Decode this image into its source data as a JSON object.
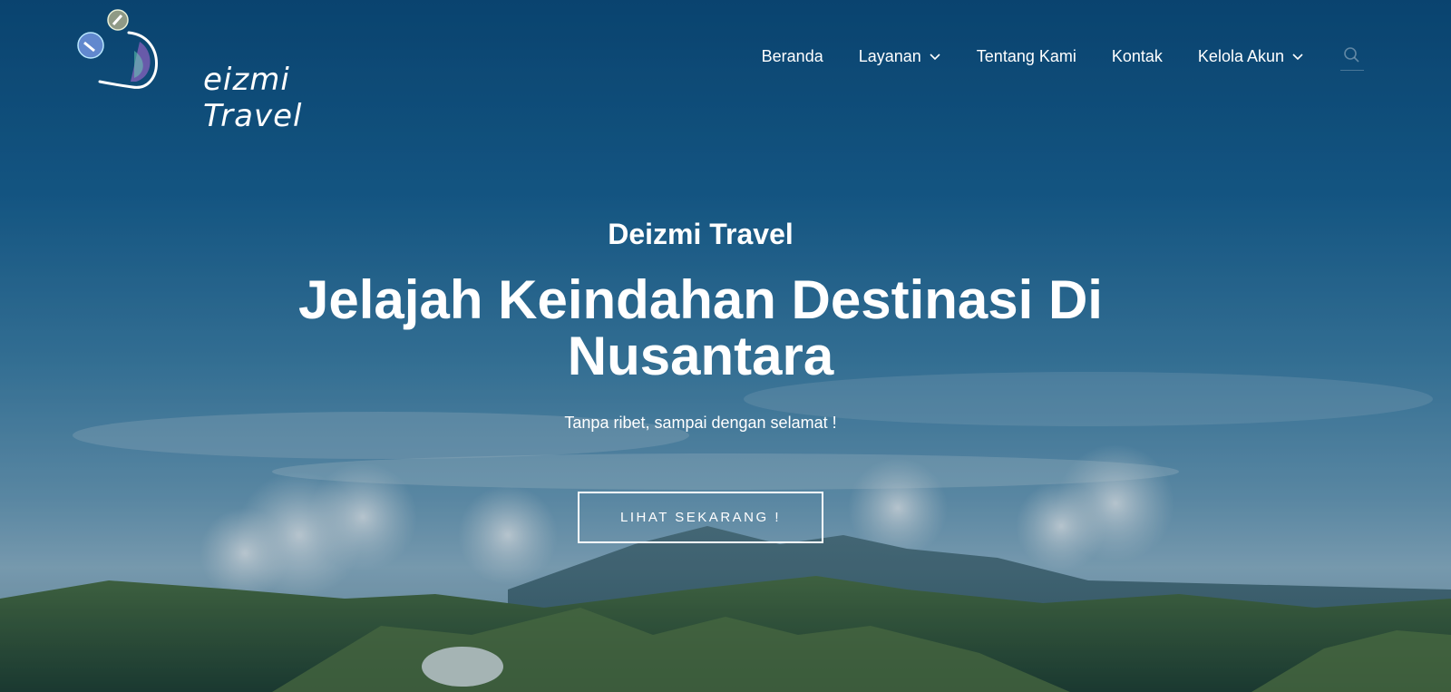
{
  "brand": {
    "name": "Deizmi Travel",
    "logo_text": "eizmi Travel"
  },
  "nav": {
    "items": [
      {
        "label": "Beranda",
        "has_dropdown": false
      },
      {
        "label": "Layanan",
        "has_dropdown": true
      },
      {
        "label": "Tentang Kami",
        "has_dropdown": false
      },
      {
        "label": "Kontak",
        "has_dropdown": false
      },
      {
        "label": "Kelola Akun",
        "has_dropdown": true
      }
    ],
    "search_icon": "search-icon",
    "chevron_icon": "chevron-down-icon"
  },
  "hero": {
    "eyebrow": "Deizmi Travel",
    "headline": "Jelajah Keindahan Destinasi Di Nusantara",
    "tagline": "Tanpa ribet, sampai dengan selamat !",
    "cta_label": "LIHAT SEKARANG !"
  },
  "colors": {
    "sky_top": "#0b4a78",
    "sky_mid": "#3d7ea3",
    "text": "#ffffff"
  }
}
